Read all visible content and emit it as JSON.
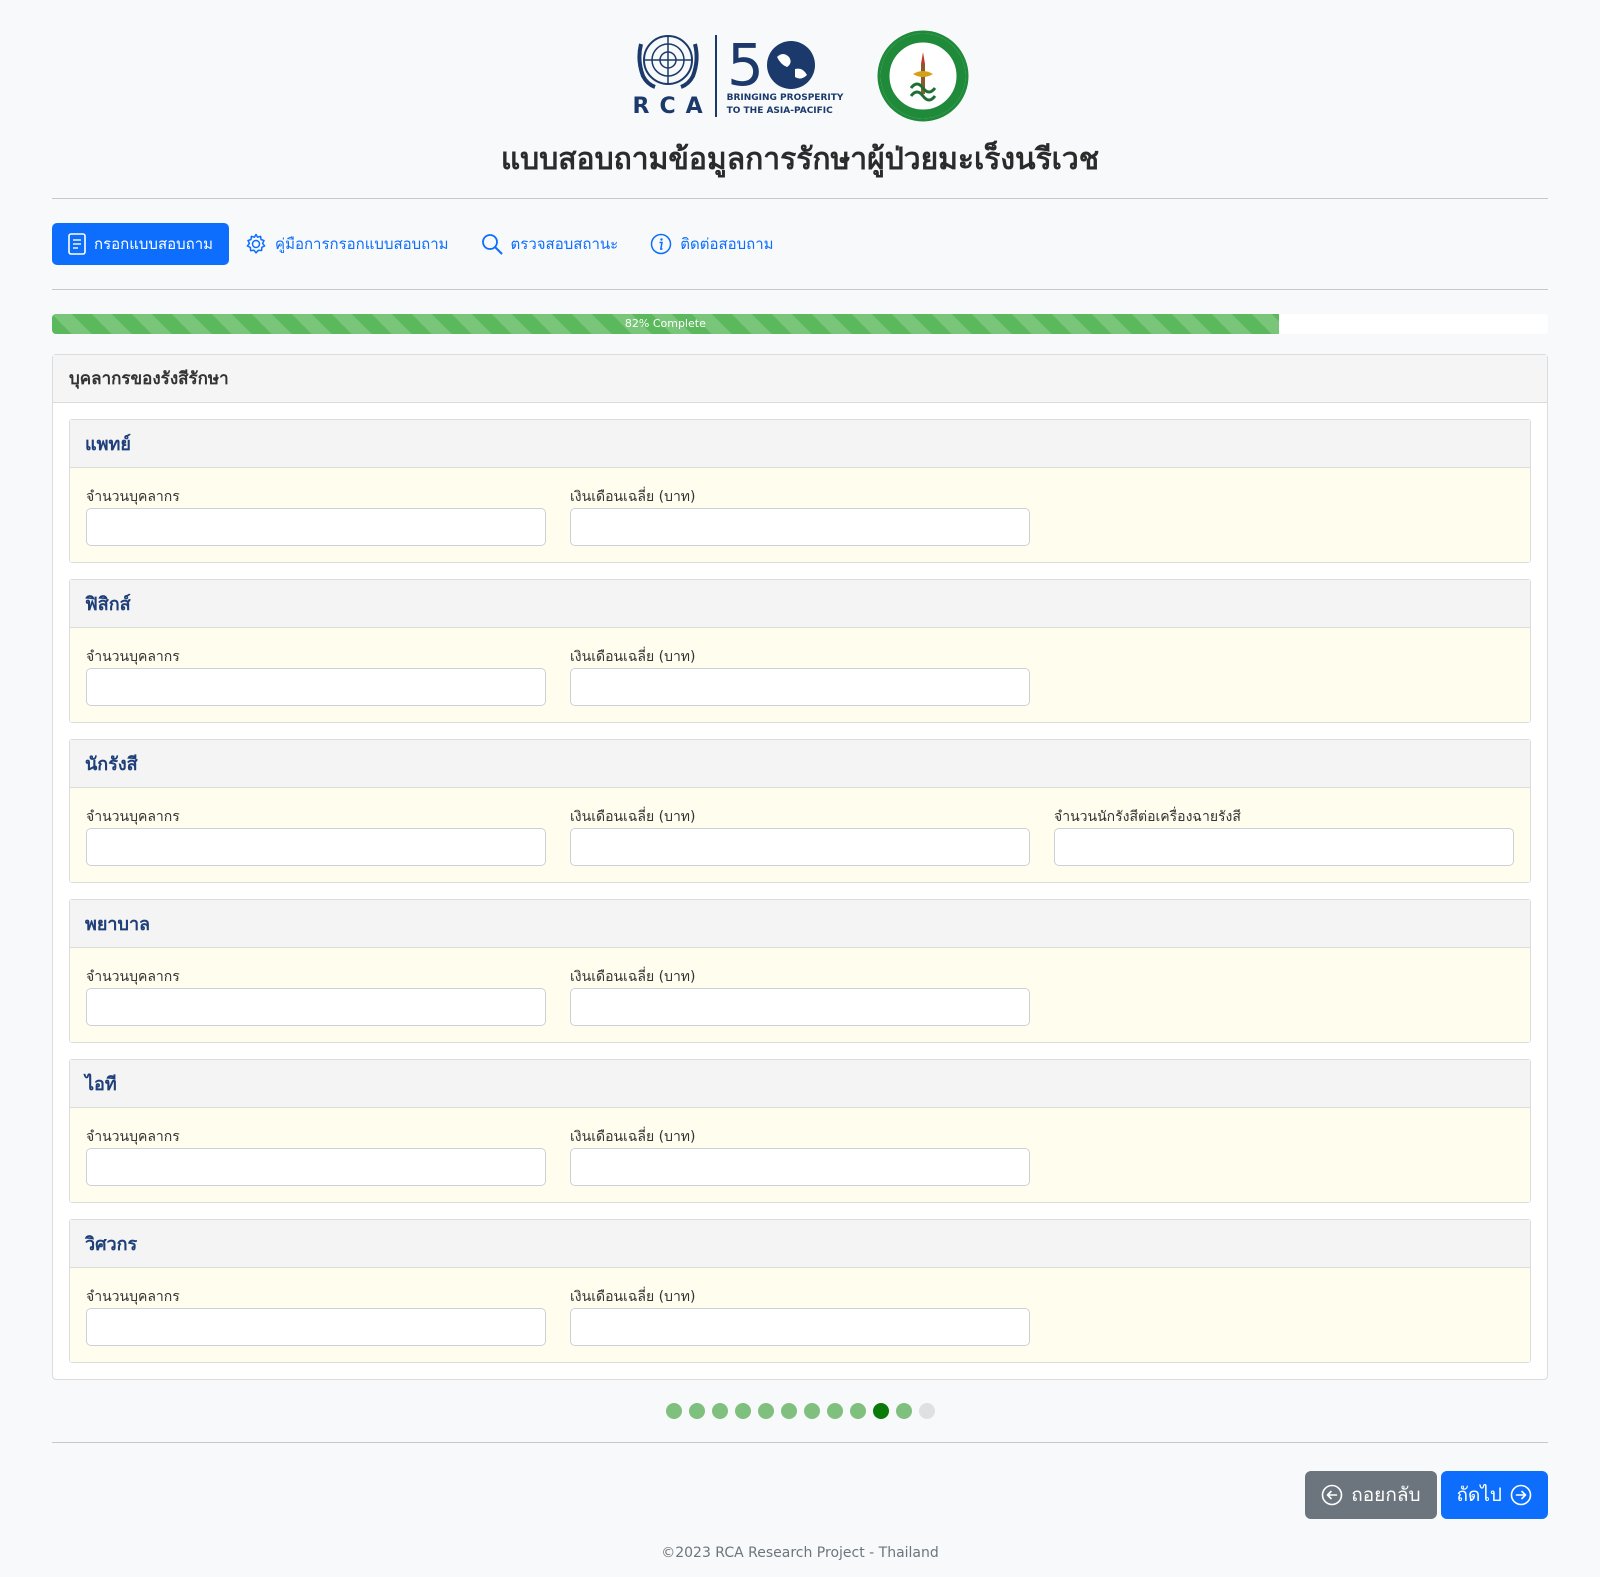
{
  "header": {
    "rca_letters": "RCA",
    "rca_anniversary": "50",
    "rca_tagline_1": "BRINGING PROSPERITY",
    "rca_tagline_2": "TO THE ASIA-PACIFIC",
    "title": "แบบสอบถามข้อมูลการรักษาผู้ป่วยมะเร็งนรีเวช"
  },
  "nav": {
    "items": [
      {
        "label": "กรอกแบบสอบถาม",
        "icon": "document-icon",
        "active": true
      },
      {
        "label": "คู่มือการกรอกแบบสอบถาม",
        "icon": "gear-icon",
        "active": false
      },
      {
        "label": "ตรวจสอบสถานะ",
        "icon": "search-icon",
        "active": false
      },
      {
        "label": "ติดต่อสอบถาม",
        "icon": "info-icon",
        "active": false
      }
    ]
  },
  "progress": {
    "value": 82,
    "label": "82% Complete",
    "color": "#5cb85c"
  },
  "section": {
    "title": "บุคลากรของรังสีรักษา",
    "groups": [
      {
        "title": "แพทย์",
        "fields": [
          {
            "label": "จำนวนบุคลากร",
            "value": ""
          },
          {
            "label": "เงินเดือนเฉลี่ย (บาท)",
            "value": ""
          }
        ]
      },
      {
        "title": "ฟิสิกส์",
        "fields": [
          {
            "label": "จำนวนบุคลากร",
            "value": ""
          },
          {
            "label": "เงินเดือนเฉลี่ย (บาท)",
            "value": ""
          }
        ]
      },
      {
        "title": "นักรังสี",
        "fields": [
          {
            "label": "จำนวนบุคลากร",
            "value": ""
          },
          {
            "label": "เงินเดือนเฉลี่ย (บาท)",
            "value": ""
          },
          {
            "label": "จำนวนนักรังสีต่อเครื่องฉายรังสี",
            "value": ""
          }
        ]
      },
      {
        "title": "พยาบาล",
        "fields": [
          {
            "label": "จำนวนบุคลากร",
            "value": ""
          },
          {
            "label": "เงินเดือนเฉลี่ย (บาท)",
            "value": ""
          }
        ]
      },
      {
        "title": "ไอที",
        "fields": [
          {
            "label": "จำนวนบุคลากร",
            "value": ""
          },
          {
            "label": "เงินเดือนเฉลี่ย (บาท)",
            "value": ""
          }
        ]
      },
      {
        "title": "วิศวกร",
        "fields": [
          {
            "label": "จำนวนบุคลากร",
            "value": ""
          },
          {
            "label": "เงินเดือนเฉลี่ย (บาท)",
            "value": ""
          }
        ]
      }
    ]
  },
  "steps": {
    "total": 12,
    "current": 10,
    "completed": [
      1,
      2,
      3,
      4,
      5,
      6,
      7,
      8,
      9,
      10,
      11
    ]
  },
  "actions": {
    "back_label": "ถอยกลับ",
    "next_label": "ถัดไป"
  },
  "footer": {
    "text": "©2023 RCA Research Project - Thailand"
  },
  "colors": {
    "primary": "#0d6efd",
    "secondary": "#6c757d",
    "group_title": "#1f3f7a",
    "group_body_bg": "#fffdee",
    "step_done": "#7fc07f",
    "step_current": "#0a7a0a",
    "step_todo": "#e0e0e0"
  }
}
